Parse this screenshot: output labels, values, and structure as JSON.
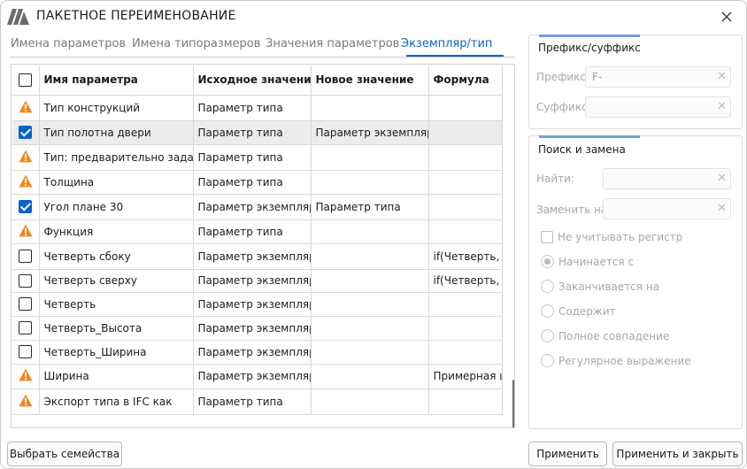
{
  "window": {
    "title": "ПАКЕТНОЕ ПЕРЕИМЕНОВАНИЕ"
  },
  "tabs": [
    {
      "label": "Имена параметров",
      "active": false
    },
    {
      "label": "Имена типоразмеров",
      "active": false
    },
    {
      "label": "Значения параметров",
      "active": false
    },
    {
      "label": "Экземпляр/тип",
      "active": true
    }
  ],
  "table": {
    "headers": [
      "Имя параметра",
      "Исходное значение",
      "Новое значение",
      "Формула"
    ],
    "rows": [
      {
        "icon": "warning",
        "name": "Тип конструкций",
        "source": "Параметр типа",
        "new": "",
        "formula": "",
        "selected": false
      },
      {
        "icon": "checked",
        "name": "Тип полотна двери",
        "source": "Параметр типа",
        "new": "Параметр экземпляра",
        "formula": "",
        "selected": true
      },
      {
        "icon": "warning",
        "name": "Тип: предварительно заданны",
        "source": "Параметр типа",
        "new": "",
        "formula": "",
        "selected": false
      },
      {
        "icon": "warning",
        "name": "Толщина",
        "source": "Параметр типа",
        "new": "",
        "formula": "",
        "selected": false
      },
      {
        "icon": "checked",
        "name": "Угол плане 30",
        "source": "Параметр экземпляра",
        "new": "Параметр типа",
        "formula": "",
        "selected": false
      },
      {
        "icon": "warning",
        "name": "Функция",
        "source": "Параметр типа",
        "new": "",
        "formula": "",
        "selected": false
      },
      {
        "icon": "unchecked",
        "name": "Четверть сбоку",
        "source": "Параметр экземпляра",
        "new": "",
        "formula": "if(Четверть, Че",
        "selected": false
      },
      {
        "icon": "unchecked",
        "name": "Четверть сверху",
        "source": "Параметр экземпляра",
        "new": "",
        "formula": "if(Четверть, Че",
        "selected": false
      },
      {
        "icon": "unchecked",
        "name": "Четверть",
        "source": "Параметр экземпляра",
        "new": "",
        "formula": "",
        "selected": false
      },
      {
        "icon": "unchecked",
        "name": "Четверть_Высота",
        "source": "Параметр экземпляра",
        "new": "",
        "formula": "",
        "selected": false
      },
      {
        "icon": "unchecked",
        "name": "Четверть_Ширина",
        "source": "Параметр экземпляра",
        "new": "",
        "formula": "",
        "selected": false
      },
      {
        "icon": "warning",
        "name": "Ширина",
        "source": "Параметр экземпляра",
        "new": "",
        "formula": "Примерная ши",
        "selected": false
      },
      {
        "icon": "warning",
        "name": "Экспорт типа в IFC как",
        "source": "Параметр типа",
        "new": "",
        "formula": "",
        "selected": false
      }
    ]
  },
  "prefix_panel": {
    "title": "Префикс/суффикс",
    "prefix_label": "Префикс:",
    "prefix_value": "F-",
    "suffix_label": "Суффикс:",
    "suffix_value": ""
  },
  "search_panel": {
    "title": "Поиск и замена",
    "find_label": "Найти:",
    "find_value": "",
    "replace_label": "Заменить на:",
    "replace_value": "",
    "ignore_case_label": "Не учитывать регистр",
    "options": [
      {
        "label": "Начинается с",
        "selected": true
      },
      {
        "label": "Заканчивается на",
        "selected": false
      },
      {
        "label": "Содержит",
        "selected": false
      },
      {
        "label": "Полное совпадение",
        "selected": false
      },
      {
        "label": "Регулярное выражение",
        "selected": false
      }
    ]
  },
  "buttons": {
    "select_families": "Выбрать семейства",
    "apply": "Применить",
    "apply_close": "Применить и закрыть"
  },
  "colors": {
    "accent": "#0a63c9",
    "warning": "#f0891e"
  }
}
